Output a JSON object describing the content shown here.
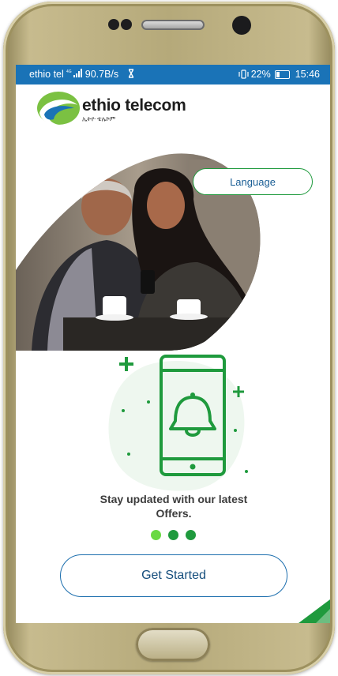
{
  "status_bar": {
    "carrier": "ethio tel",
    "network_speed": "90.7B/s",
    "battery_percent": "22%",
    "time": "15:46"
  },
  "brand": {
    "name": "ethio telecom",
    "tagline_amharic": "ኢትዮ ቴሌኮም"
  },
  "language_button": {
    "label": "Language"
  },
  "onboarding": {
    "caption_line1": "Stay updated with our latest",
    "caption_line2": "Offers.",
    "current_page": 1,
    "page_count": 3
  },
  "cta": {
    "label": "Get Started"
  },
  "colors": {
    "status_bar": "#1a73b7",
    "brand_green": "#1f9a3d",
    "active_dot": "#69d943",
    "button_text": "#144d7c"
  },
  "icons": [
    "network-signal-icon",
    "hourglass-icon",
    "vibrate-icon",
    "battery-icon",
    "bell-phone-icon"
  ]
}
